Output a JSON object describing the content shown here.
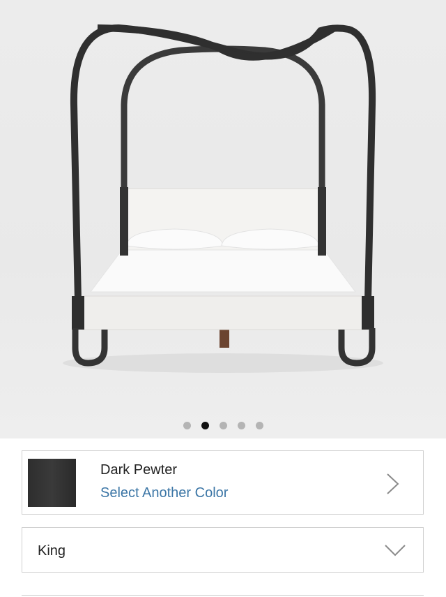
{
  "product_image": {
    "icon": "bed-image",
    "slides_total": 5,
    "active_slide": 2
  },
  "color": {
    "name": "Dark Pewter",
    "link": "Select Another Color",
    "swatch_color": "#333333",
    "link_color": "#3c76a6"
  },
  "size": {
    "value": "King"
  }
}
